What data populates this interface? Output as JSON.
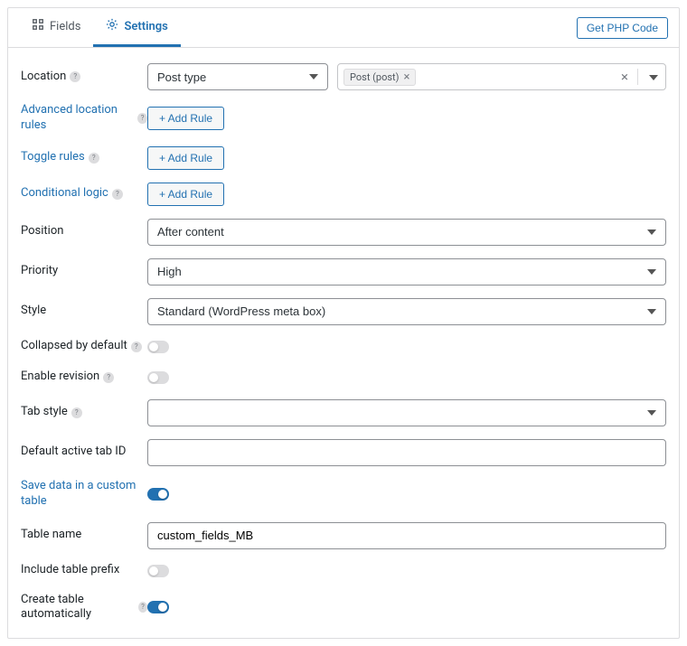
{
  "tabs": {
    "fields": "Fields",
    "settings": "Settings"
  },
  "php_btn": "Get PHP Code",
  "labels": {
    "location": "Location",
    "adv_rules": "Advanced location rules",
    "toggle_rules": "Toggle rules",
    "cond_logic": "Conditional logic",
    "position": "Position",
    "priority": "Priority",
    "style": "Style",
    "collapsed": "Collapsed by default",
    "enable_revision": "Enable revision",
    "tab_style": "Tab style",
    "default_tab": "Default active tab ID",
    "save_custom": "Save data in a custom table",
    "table_name": "Table name",
    "include_prefix": "Include table prefix",
    "create_auto": "Create table automatically"
  },
  "values": {
    "location_select": "Post type",
    "location_tag": "Post (post)",
    "position": "After content",
    "priority": "High",
    "style": "Standard (WordPress meta box)",
    "table_name": "custom_fields_MB"
  },
  "add_rule": "+ Add Rule"
}
